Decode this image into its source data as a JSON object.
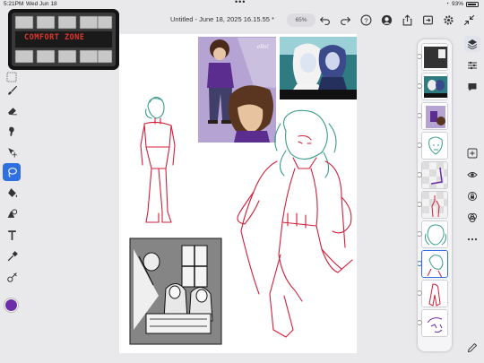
{
  "status": {
    "time": "5:21PM",
    "date": "Wed Jun 18",
    "battery": "93%"
  },
  "document": {
    "title": "Untitled - June 18, 2025 16.15.55 *",
    "zoom": "65%"
  },
  "pip": {
    "banner": "COMFORT ZONE"
  },
  "colors": {
    "accent": "#2f6fe0",
    "brush": "#d11f3a",
    "current_color": "#6b2ea8"
  },
  "left_tools": [
    "grid-icon",
    "brush-icon",
    "eraser-icon",
    "smudge-icon",
    "move-icon",
    "lasso-icon",
    "fill-icon",
    "shape-icon",
    "text-icon",
    "eyedropper-icon",
    "adjust-icon"
  ],
  "top_icons": [
    "undo-icon",
    "redo-icon",
    "help-icon",
    "account-icon",
    "share-icon",
    "export-icon",
    "settings-icon",
    "collapse-icon"
  ],
  "right_tools": [
    "layers-icon",
    "properties-icon",
    "comments-icon",
    "add-layer-icon",
    "visibility-icon",
    "lock-icon",
    "blend-icon",
    "more-icon"
  ]
}
